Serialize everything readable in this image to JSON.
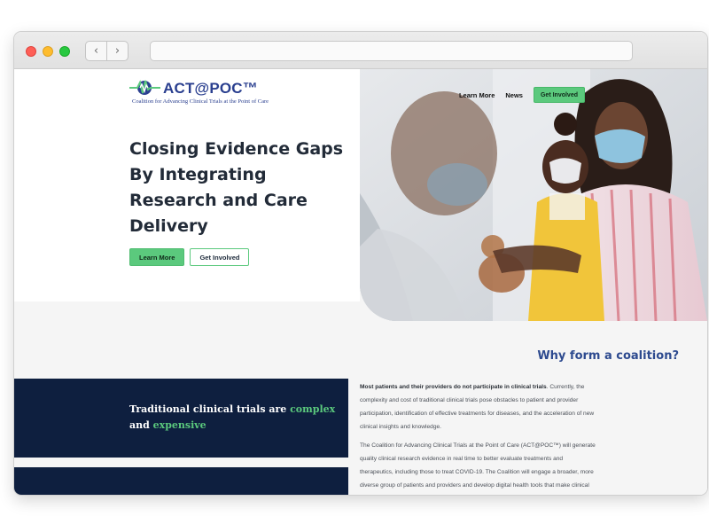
{
  "browser": {
    "back": "‹",
    "forward": "›",
    "url": ""
  },
  "brand": {
    "name": "ACT@POC™",
    "tagline": "Coalition for Advancing Clinical Trials at the Point of Care",
    "color": "#2a3f8f",
    "accent": "#5bc97d"
  },
  "nav": {
    "learn_more": "Learn More",
    "news": "News",
    "get_involved": "Get Involved"
  },
  "hero": {
    "headline": "Closing Evidence Gaps By Integrating Research and Care Delivery",
    "primary_button": "Learn More",
    "secondary_button": "Get Involved"
  },
  "why": {
    "title": "Why form a coalition?",
    "panel_prefix": "Traditional clinical trials are ",
    "panel_word1": "complex",
    "panel_mid": " and ",
    "panel_word2": "expensive",
    "para1_bold": "Most patients and their providers do not participate in clinical trials",
    "para1_rest": ". Currently, the complexity and cost of traditional clinical trials pose obstacles to patient and provider participation, identification of effective treatments for diseases, and the acceleration of new clinical insights and knowledge.",
    "para2": "The Coalition for Advancing Clinical Trials at the Point of Care (ACT@POC™) will generate quality clinical research evidence in real time to better evaluate treatments and therapeutics, including those to treat COVID-19. The Coalition will engage a broader, more diverse group of patients and providers and develop digital health tools that make clinical trials simpler to run and more accessible to patients."
  }
}
